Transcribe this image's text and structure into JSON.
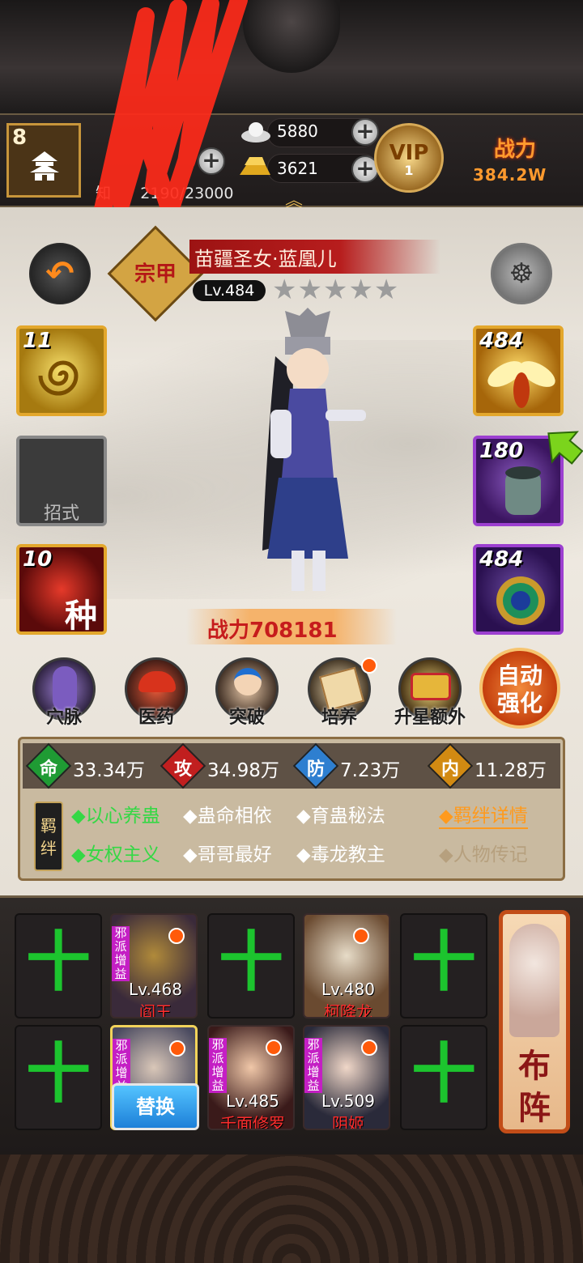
{
  "header": {
    "level": "8",
    "silver": "5880",
    "gold": "3621",
    "xp": "2190/23000",
    "xp_prefix": "知",
    "vip_label": "VIP",
    "vip_level": "1",
    "power_label": "战力",
    "power_value": "384.2W"
  },
  "hero": {
    "badge": "宗甲",
    "name": "苗疆圣女·蓝凰儿",
    "level": "Lv.484",
    "stars": "★★★★★",
    "power": "战力708181",
    "skill_empty_label": "招式"
  },
  "slots": {
    "left_top": "11",
    "left_bottom": "10",
    "left_bottom_char": "种",
    "right_top": "484",
    "right_mid": "180",
    "right_bottom": "484"
  },
  "functions": [
    {
      "label": "穴脉"
    },
    {
      "label": "医药"
    },
    {
      "label": "突破"
    },
    {
      "label": "培养"
    },
    {
      "label": "升星额外"
    }
  ],
  "auto_button": {
    "line1": "自动",
    "line2": "强化"
  },
  "stats": [
    {
      "char": "命",
      "value": "33.34万",
      "color": "#1f9b34"
    },
    {
      "char": "攻",
      "value": "34.98万",
      "color": "#c11f1f"
    },
    {
      "char": "防",
      "value": "7.23万",
      "color": "#2e7fd0"
    },
    {
      "char": "内",
      "value": "11.28万",
      "color": "#d28a12"
    }
  ],
  "bonds": {
    "tag": "羁绊",
    "row1": [
      "◆以心养蛊",
      "◆蛊命相依",
      "◆育蛊秘法"
    ],
    "row2": [
      "◆女权主义",
      "◆哥哥最好",
      "◆毒龙教主"
    ],
    "link_detail": "◆羁绊详情",
    "link_bio": "◆人物传记"
  },
  "lineup": {
    "plus": "十",
    "evil_tag": "邪派增益",
    "heroes": [
      {
        "level": "Lv.468",
        "name": "阎王"
      },
      {
        "level": "Lv.480",
        "name": "柯降龙"
      },
      {
        "level": "Lv.485",
        "name": "千面修罗"
      },
      {
        "level": "Lv.509",
        "name": "阴姬"
      }
    ],
    "swap_label": "替换",
    "formation_label": "布阵"
  },
  "colors": {
    "accent_gold": "#e3a72c",
    "bond_active": "#35d845",
    "power_red": "#c61c1c"
  }
}
